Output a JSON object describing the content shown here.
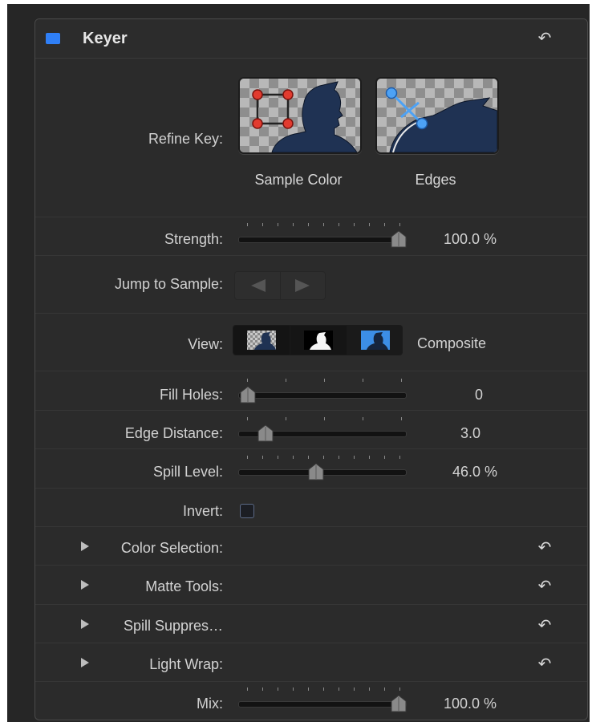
{
  "header": {
    "title": "Keyer",
    "enabled": true,
    "accent": "#2f7ff6"
  },
  "refine_key": {
    "label": "Refine Key:",
    "tiles": [
      {
        "caption": "Sample Color",
        "icon": "sample-color-icon"
      },
      {
        "caption": "Edges",
        "icon": "edges-icon"
      }
    ]
  },
  "strength": {
    "label": "Strength:",
    "value_text": "100.0 %",
    "value": 100
  },
  "jump_to_sample": {
    "label": "Jump to Sample:",
    "prev_icon": "triangle-left-icon",
    "next_icon": "triangle-right-icon"
  },
  "view": {
    "label": "View:",
    "selected_text": "Composite",
    "options": [
      "composite-view-icon",
      "matte-view-icon",
      "original-view-icon"
    ],
    "selected_index": 0
  },
  "fill_holes": {
    "label": "Fill Holes:",
    "value_text": "0",
    "value": 0
  },
  "edge_distance": {
    "label": "Edge Distance:",
    "value_text": "3.0",
    "value": 3.0
  },
  "spill_level": {
    "label": "Spill Level:",
    "value_text": "46.0 %",
    "value": 46
  },
  "invert": {
    "label": "Invert:",
    "checked": false
  },
  "groups": [
    {
      "label": "Color Selection:"
    },
    {
      "label": "Matte Tools:"
    },
    {
      "label": "Spill Suppres…"
    },
    {
      "label": "Light Wrap:"
    }
  ],
  "mix": {
    "label": "Mix:",
    "value_text": "100.0 %",
    "value": 100
  }
}
